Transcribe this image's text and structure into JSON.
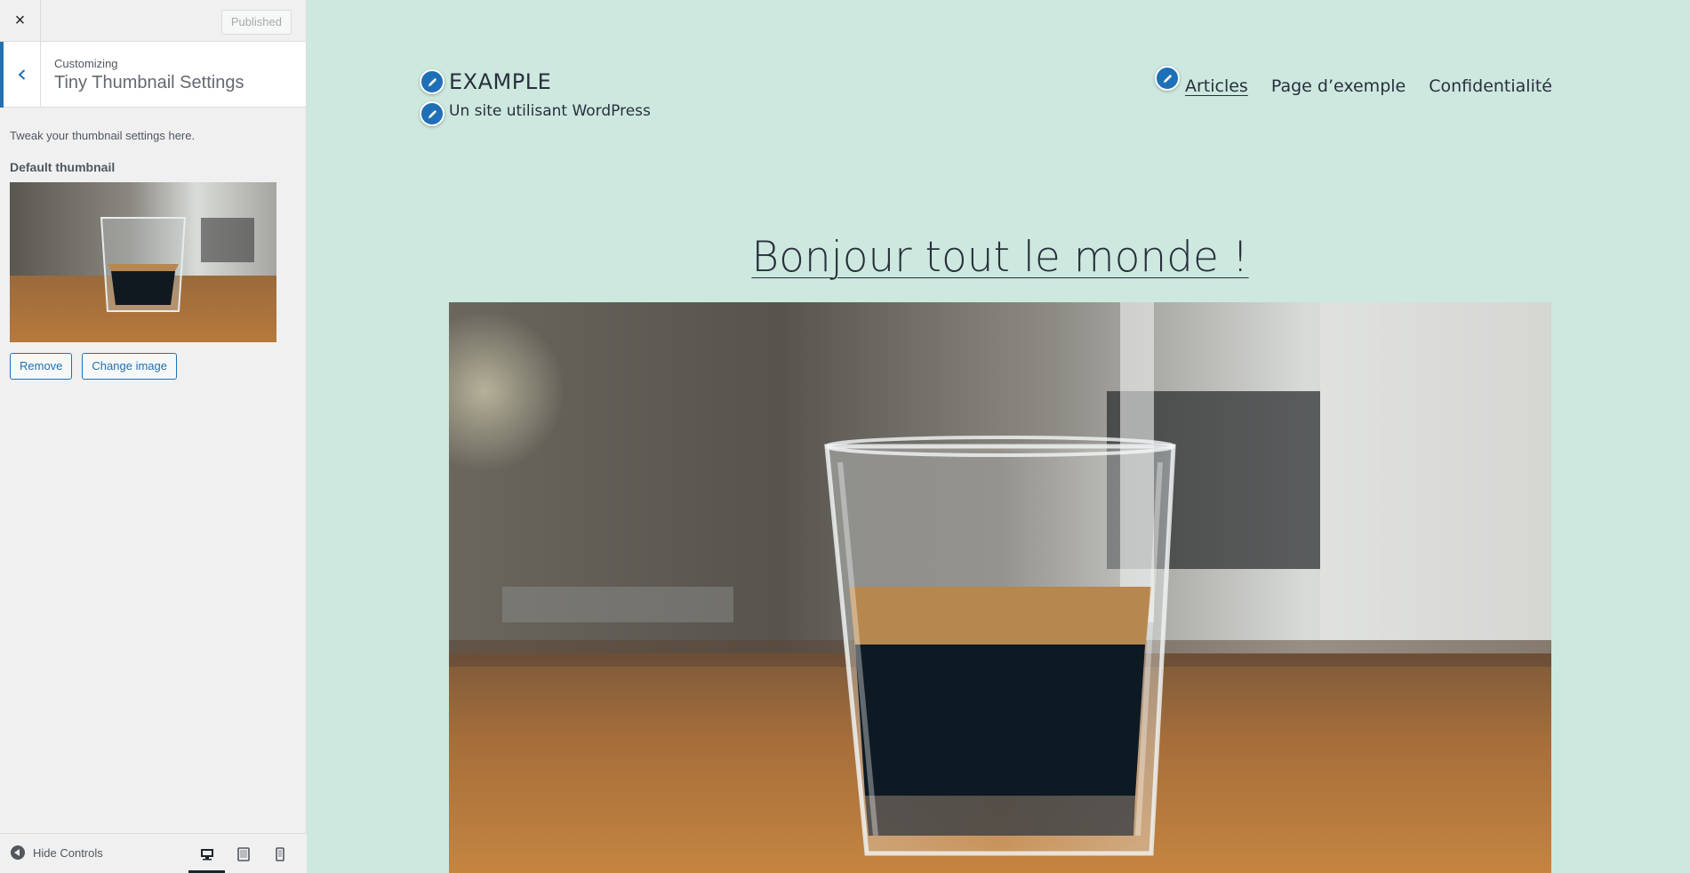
{
  "customizer": {
    "close_label": "×",
    "publish_label": "Published",
    "breadcrumb": "Customizing",
    "section_title": "Tiny Thumbnail Settings",
    "description": "Tweak your thumbnail settings here.",
    "control_label": "Default thumbnail",
    "remove_label": "Remove",
    "change_label": "Change image",
    "hide_controls_label": "Hide Controls",
    "accent_color": "#2271b1"
  },
  "preview": {
    "site_title": "EXAMPLE",
    "site_tagline": "Un site utilisant WordPress",
    "nav": [
      "Articles",
      "Page d’exemple",
      "Confidentialité"
    ],
    "post_title": "Bonjour tout le monde !",
    "background_color": "#cde8de"
  }
}
